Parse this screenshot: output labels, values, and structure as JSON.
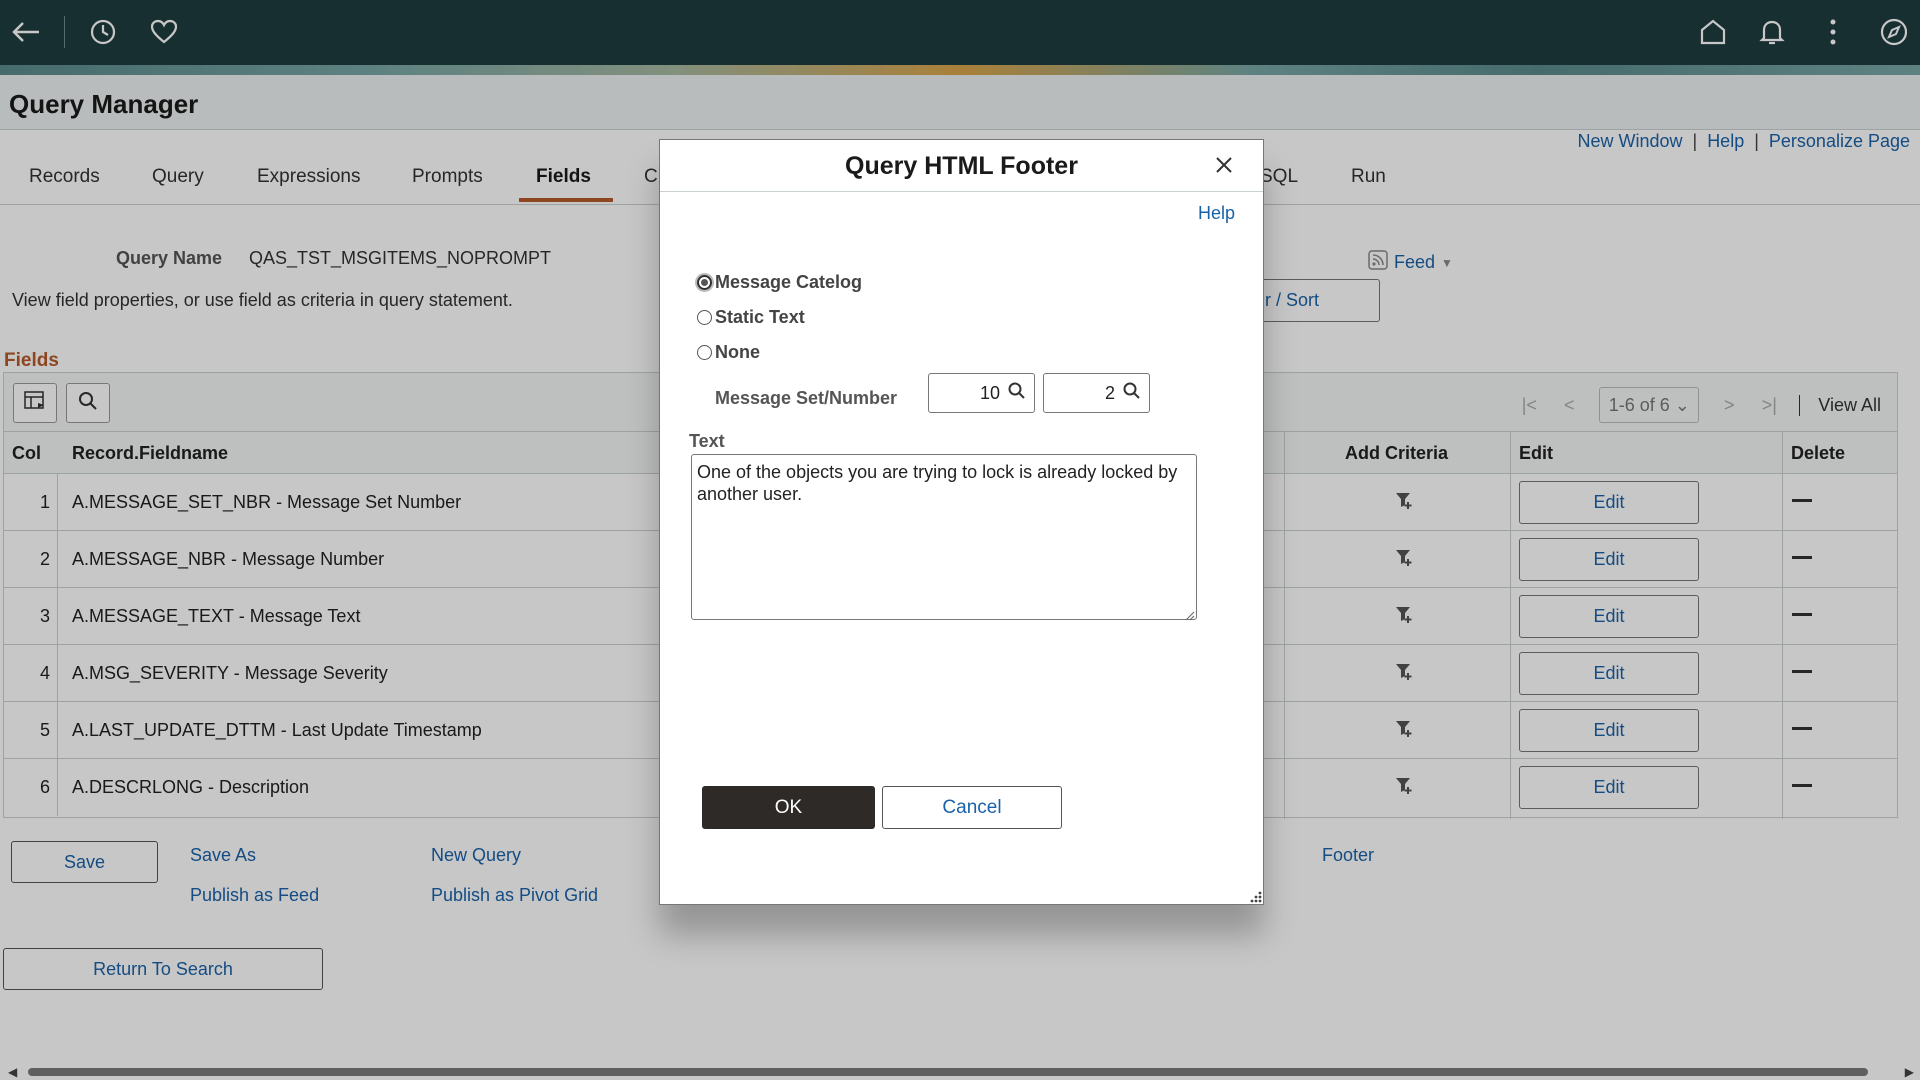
{
  "app": {
    "title": "Query Manager"
  },
  "header_links": [
    "New Window",
    "Help",
    "Personalize Page"
  ],
  "tabs": [
    {
      "label": "Records",
      "active": false
    },
    {
      "label": "Query",
      "active": false
    },
    {
      "label": "Expressions",
      "active": false
    },
    {
      "label": "Prompts",
      "active": false
    },
    {
      "label": "Fields",
      "active": true
    },
    {
      "label": "C",
      "active": false
    },
    {
      "label": "SQL",
      "active": false
    },
    {
      "label": "Run",
      "active": false
    }
  ],
  "query": {
    "name_label": "Query Name",
    "name_value": "QAS_TST_MSGITEMS_NOPROMPT",
    "description": "View field properties, or use field as criteria in query statement.",
    "feed_label": "Feed",
    "sort_label": "r / Sort"
  },
  "fields": {
    "title": "Fields",
    "pager_range": "1-6 of 6",
    "view_all": "View All",
    "columns": {
      "col": "Col",
      "name": "Record.Fieldname",
      "add_criteria": "Add Criteria",
      "edit": "Edit",
      "delete": "Delete"
    },
    "edit_label": "Edit",
    "rows": [
      {
        "col": "1",
        "name": "A.MESSAGE_SET_NBR - Message Set Number"
      },
      {
        "col": "2",
        "name": "A.MESSAGE_NBR - Message Number"
      },
      {
        "col": "3",
        "name": "A.MESSAGE_TEXT - Message Text"
      },
      {
        "col": "4",
        "name": "A.MSG_SEVERITY - Message Severity"
      },
      {
        "col": "5",
        "name": "A.LAST_UPDATE_DTTM - Last Update Timestamp"
      },
      {
        "col": "6",
        "name": "A.DESCRLONG - Description"
      }
    ]
  },
  "actions": {
    "save": "Save",
    "save_as": "Save As",
    "new_query": "New Query",
    "footer": "Footer",
    "publish_feed": "Publish as Feed",
    "publish_pivot": "Publish as Pivot Grid",
    "return_to_search": "Return To Search"
  },
  "modal": {
    "title": "Query HTML Footer",
    "help": "Help",
    "options": [
      {
        "label": "Message Catelog",
        "checked": true
      },
      {
        "label": "Static Text",
        "checked": false
      },
      {
        "label": "None",
        "checked": false
      }
    ],
    "message_set_label": "Message Set/Number",
    "message_set_value": "10",
    "message_number_value": "2",
    "text_label": "Text",
    "text_value": "One of the objects you are trying to lock is already locked by another user.",
    "ok": "OK",
    "cancel": "Cancel"
  },
  "colors": {
    "topbar": "#1f3d3f",
    "link": "#1a62a8",
    "accent": "#b55a2a",
    "ok_button": "#2e2a28"
  }
}
